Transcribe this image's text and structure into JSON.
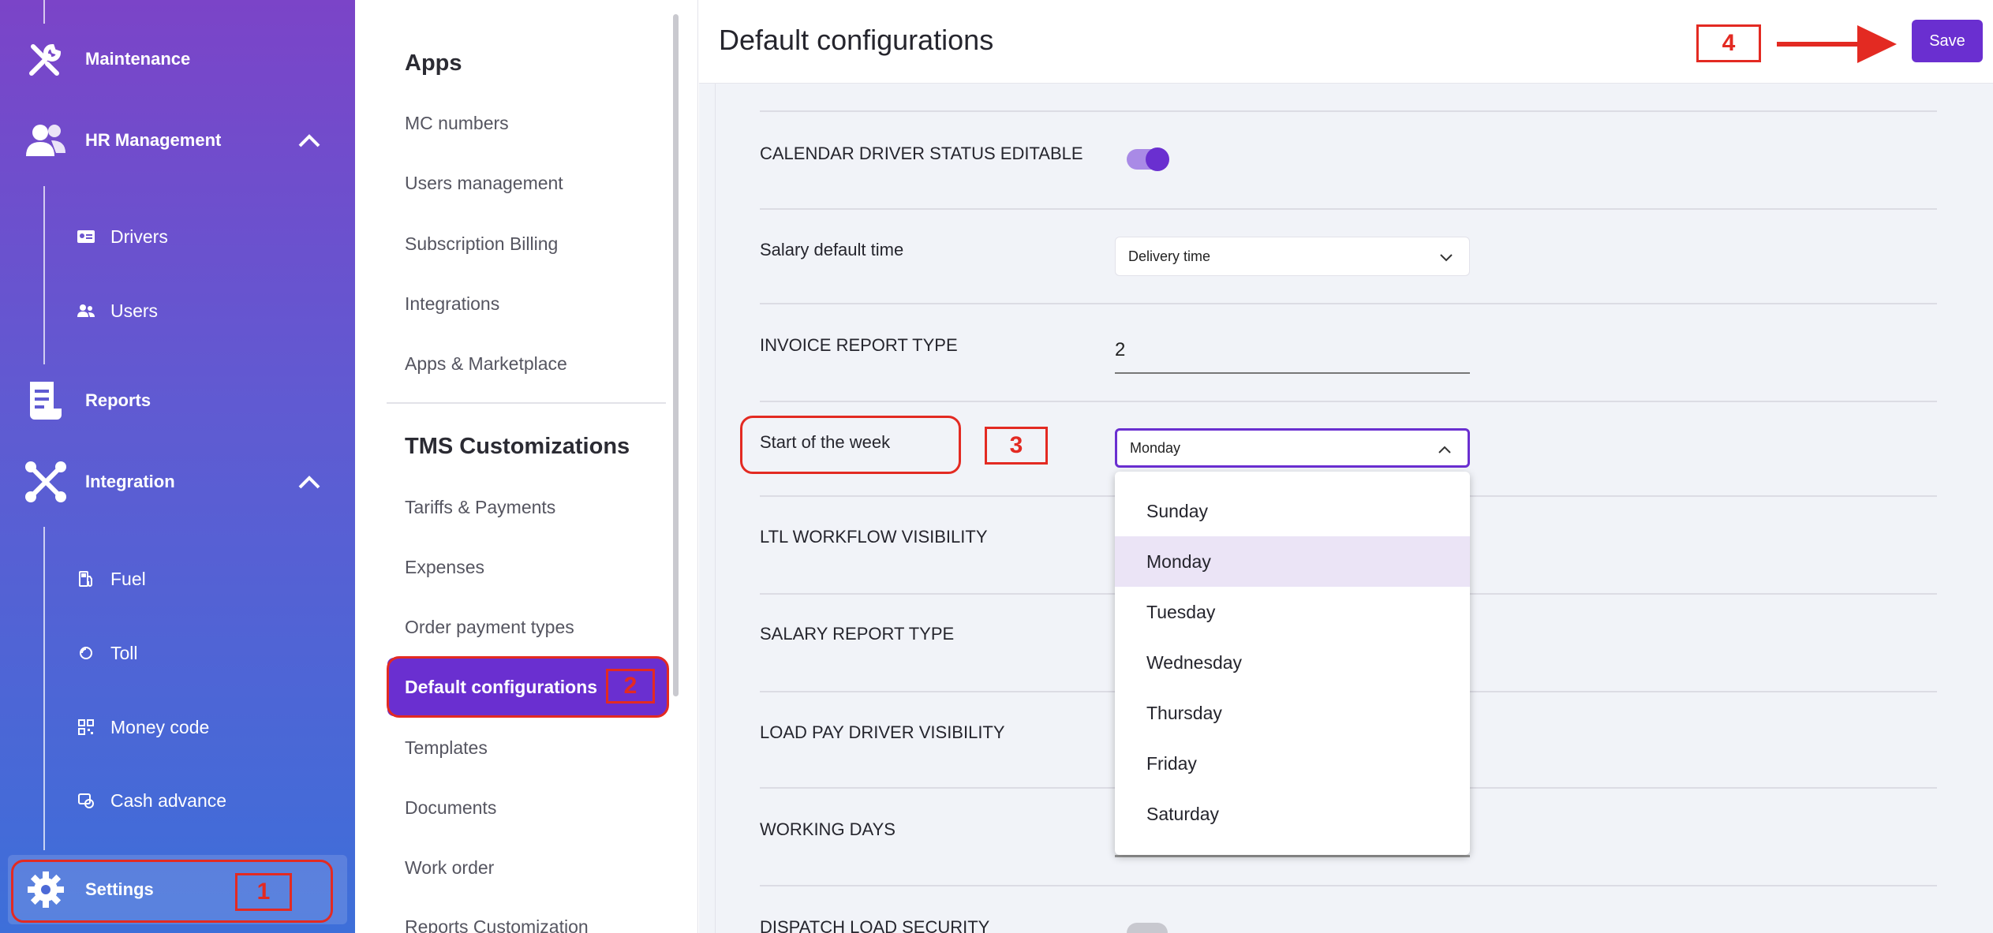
{
  "sidebar": {
    "maintenance": "Maintenance",
    "hr_management": "HR Management",
    "drivers": "Drivers",
    "users": "Users",
    "reports": "Reports",
    "integration": "Integration",
    "fuel": "Fuel",
    "toll": "Toll",
    "money_code": "Money code",
    "cash_advance": "Cash advance",
    "settings": "Settings"
  },
  "middle_nav": {
    "apps_heading": "Apps",
    "apps_items": [
      "MC numbers",
      "Users management",
      "Subscription Billing",
      "Integrations",
      "Apps & Marketplace"
    ],
    "tms_heading": "TMS Customizations",
    "tms_items": [
      "Tariffs & Payments",
      "Expenses",
      "Order payment types",
      "Default configurations",
      "Templates",
      "Documents",
      "Work order",
      "Reports Customization"
    ],
    "active_item": "Default configurations"
  },
  "header": {
    "title": "Default configurations",
    "save_label": "Save"
  },
  "settings": {
    "calendar_driver_status_editable": "CALENDAR DRIVER STATUS EDITABLE",
    "salary_default_time": "Salary default time",
    "salary_default_time_value": "Delivery time",
    "invoice_report_type": "INVOICE REPORT TYPE",
    "invoice_report_type_value": "2",
    "start_of_week": "Start of the week",
    "start_of_week_value": "Monday",
    "ltl_workflow_visibility": "LTL WORKFLOW VISIBILITY",
    "salary_report_type": "SALARY REPORT TYPE",
    "load_pay_driver_visibility": "LOAD PAY DRIVER VISIBILITY",
    "working_days": "WORKING DAYS",
    "dispatch_load_security": "DISPATCH LOAD SECURITY"
  },
  "week_dropdown": {
    "options": [
      "Sunday",
      "Monday",
      "Tuesday",
      "Wednesday",
      "Thursday",
      "Friday",
      "Saturday"
    ],
    "selected": "Monday"
  },
  "annotations": {
    "step1": "1",
    "step2": "2",
    "step3": "3",
    "step4": "4"
  },
  "colors": {
    "accent": "#6a2fd0",
    "annotation": "#e32a22"
  }
}
